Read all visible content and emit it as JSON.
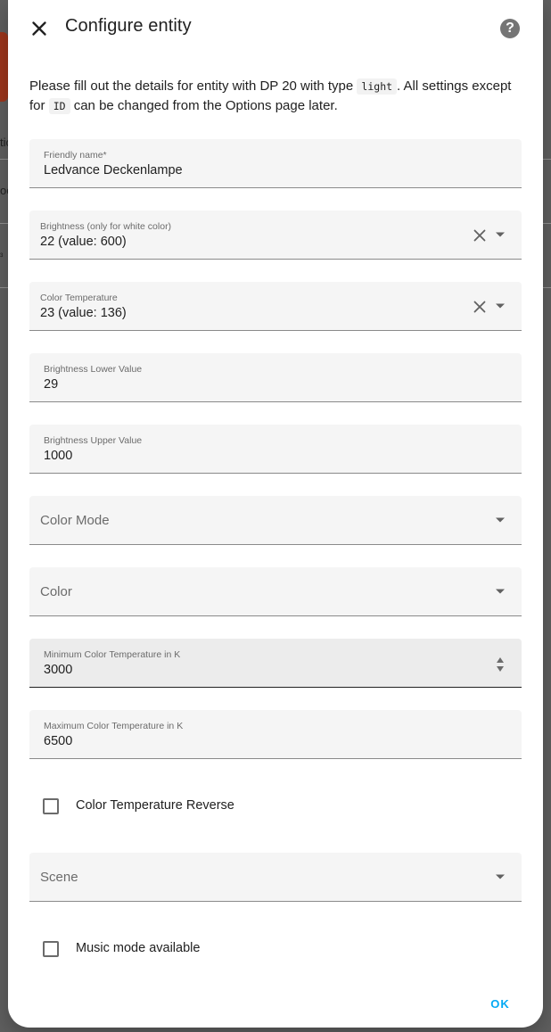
{
  "dialog": {
    "title": "Configure entity",
    "help_symbol": "?",
    "close_icon": "close-icon",
    "description_pre": "Please fill out the details for entity with DP 20 with type ",
    "description_code1": "light",
    "description_mid": ". All settings except for ",
    "description_code2": "ID",
    "description_post": " can be changed from the Options page later.",
    "ok_label": "OK",
    "accent_color": "#03a9f4"
  },
  "fields": {
    "friendly_name": {
      "label": "Friendly name*",
      "value": "Ledvance Deckenlampe"
    },
    "brightness": {
      "label": "Brightness (only for white color)",
      "value": "22 (value: 600)"
    },
    "color_temp": {
      "label": "Color Temperature",
      "value": "23 (value: 136)"
    },
    "brightness_lower": {
      "label": "Brightness Lower Value",
      "value": "29"
    },
    "brightness_upper": {
      "label": "Brightness Upper Value",
      "value": "1000"
    },
    "color_mode": {
      "placeholder": "Color Mode"
    },
    "color": {
      "placeholder": "Color"
    },
    "min_color_temp": {
      "label": "Minimum Color Temperature in K",
      "value": "3000"
    },
    "max_color_temp": {
      "label": "Maximum Color Temperature in K",
      "value": "6500"
    },
    "color_temp_reverse": {
      "label": "Color Temperature Reverse",
      "checked": false
    },
    "scene": {
      "placeholder": "Scene"
    },
    "music_mode": {
      "label": "Music mode available",
      "checked": false
    }
  },
  "background": {
    "fragment_1": "tic",
    "fragment_2": "oc",
    "fragment_3": "³"
  }
}
